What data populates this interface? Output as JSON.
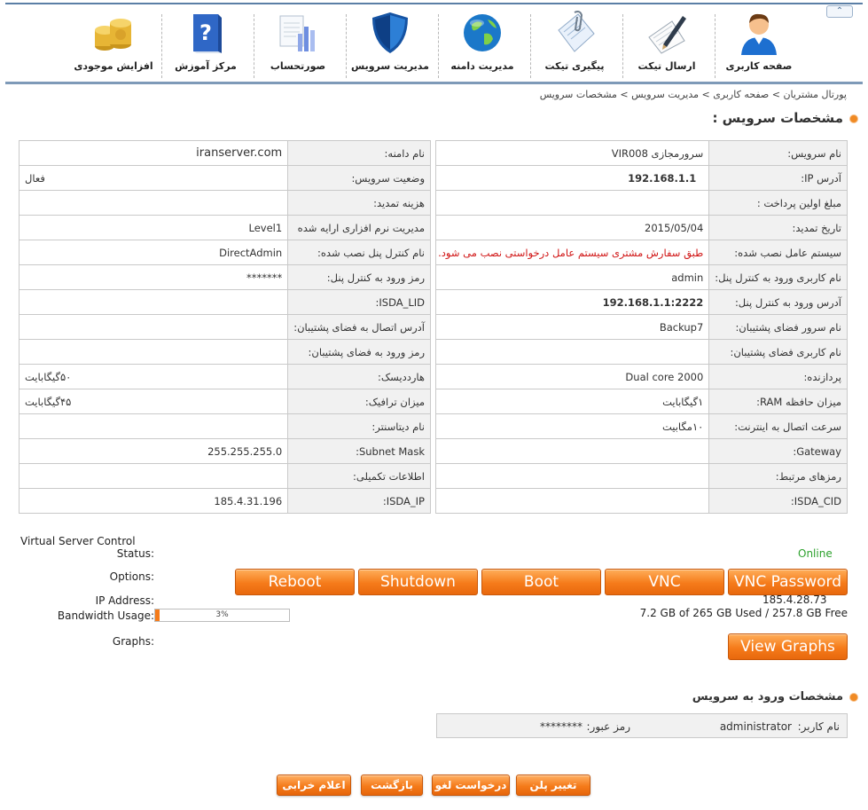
{
  "nav": {
    "items": [
      {
        "label": "صفحه کاربری",
        "icon": "user-icon"
      },
      {
        "label": "ارسال تیکت",
        "icon": "pen-paper-icon"
      },
      {
        "label": "پیگیری تیکت",
        "icon": "clipboard-clip-icon"
      },
      {
        "label": "مدیریت دامنه",
        "icon": "globe-icon"
      },
      {
        "label": "مدیریت سرویس",
        "icon": "shield-icon"
      },
      {
        "label": "صورتحساب",
        "icon": "invoice-chart-icon"
      },
      {
        "label": "مرکز آموزش",
        "icon": "help-book-icon"
      },
      {
        "label": "افزایش موجودی",
        "icon": "coins-icon"
      }
    ]
  },
  "breadcrumb": "پورتال مشتریان > صفحه کاربری > مدیریت سرویس > مشخصات سرویس",
  "service": {
    "title": "مشخصات سرویس :",
    "right_rows": [
      {
        "label": "نام سرویس:",
        "value": "سرورمجازی VIR008"
      },
      {
        "label": "آدرس IP:",
        "value": "192.168.1.1"
      },
      {
        "label": "مبلغ اولین پرداخت :",
        "value": ""
      },
      {
        "label": "تاریخ تمدید:",
        "value": "2015/05/04"
      },
      {
        "label": "سیستم عامل نصب شده:",
        "value": "طبق سفارش مشتری سیستم عامل درخواستی نصب می شود."
      },
      {
        "label": "نام کاربری ورود به کنترل پنل:",
        "value": "admin"
      },
      {
        "label": "آدرس ورود به کنترل پنل:",
        "value": "192.168.1.1:2222"
      },
      {
        "label": "نام سرور فضای پشتیبان:",
        "value": "Backup7"
      },
      {
        "label": "نام کاربری فضای پشتیبان:",
        "value": ""
      },
      {
        "label": "پردازنده:",
        "value": "Dual core 2000"
      },
      {
        "label": "میزان حافظه RAM:",
        "value": "۱گیگابایت"
      },
      {
        "label": "سرعت اتصال به اینترنت:",
        "value": "۱۰مگابیت"
      },
      {
        "label": "Gateway:",
        "value": ""
      },
      {
        "label": "رمزهای مرتبط:",
        "value": ""
      },
      {
        "label": "ISDA_CID:",
        "value": ""
      }
    ],
    "left_rows": [
      {
        "label": "نام دامنه:",
        "value": "iranserver.com"
      },
      {
        "label": "وضعیت سرویس:",
        "value": "فعال"
      },
      {
        "label": "هزینه تمدید:",
        "value": ""
      },
      {
        "label": "مدیریت نرم افزاری ارایه شده",
        "value": "Level1"
      },
      {
        "label": "نام کنترل پنل نصب شده:",
        "value": "DirectAdmin"
      },
      {
        "label": "رمز ورود به کنترل پنل:",
        "value": "*******"
      },
      {
        "label": "ISDA_LID:",
        "value": ""
      },
      {
        "label": "آدرس اتصال به فضای پشتیبان:",
        "value": ""
      },
      {
        "label": "رمز ورود به فضای پشتیبان:",
        "value": ""
      },
      {
        "label": "هاردديسک:",
        "value": "۵۰گیگابایت"
      },
      {
        "label": "میزان ترافیک:",
        "value": "۴۵گیگابایت"
      },
      {
        "label": "نام دیتاسنتر:",
        "value": ""
      },
      {
        "label": "Subnet Mask:",
        "value": "255.255.255.0"
      },
      {
        "label": "اطلاعات تکمیلی:",
        "value": ""
      },
      {
        "label": "ISDA_IP:",
        "value": "185.4.31.196"
      }
    ]
  },
  "vsc": {
    "title": "Virtual Server Control",
    "status_label": "Status:",
    "status_value": "Online",
    "options_label": "Options:",
    "buttons": {
      "reboot": "Reboot",
      "shutdown": "Shutdown",
      "boot": "Boot",
      "vnc": "VNC",
      "vnc_password": "VNC Password"
    },
    "ip_label": "IP Address:",
    "ip_value": "185.4.28.73",
    "bandwidth_label": "Bandwidth Usage:",
    "bandwidth_percent": 3,
    "bandwidth_percent_text": "3%",
    "bandwidth_text": "7.2 GB of 265 GB Used / 257.8 GB Free",
    "graphs_label": "Graphs:",
    "view_graphs": "View Graphs"
  },
  "login": {
    "title": "مشخصات ورود به سرویس",
    "username_label": "نام کاربر:",
    "username_value": "administrator",
    "password_label": "رمز عبور:",
    "password_value": "********"
  },
  "actions": {
    "change_plan": "تغییر پلن",
    "cancel_request": "درخواست لغو",
    "back": "بازگشت",
    "report_issue": "اعلام خرابی"
  },
  "colors": {
    "accent": "#f57b1a",
    "online": "#2da12d",
    "warning_text": "#d01414",
    "header_line": "#7e9ab8"
  }
}
